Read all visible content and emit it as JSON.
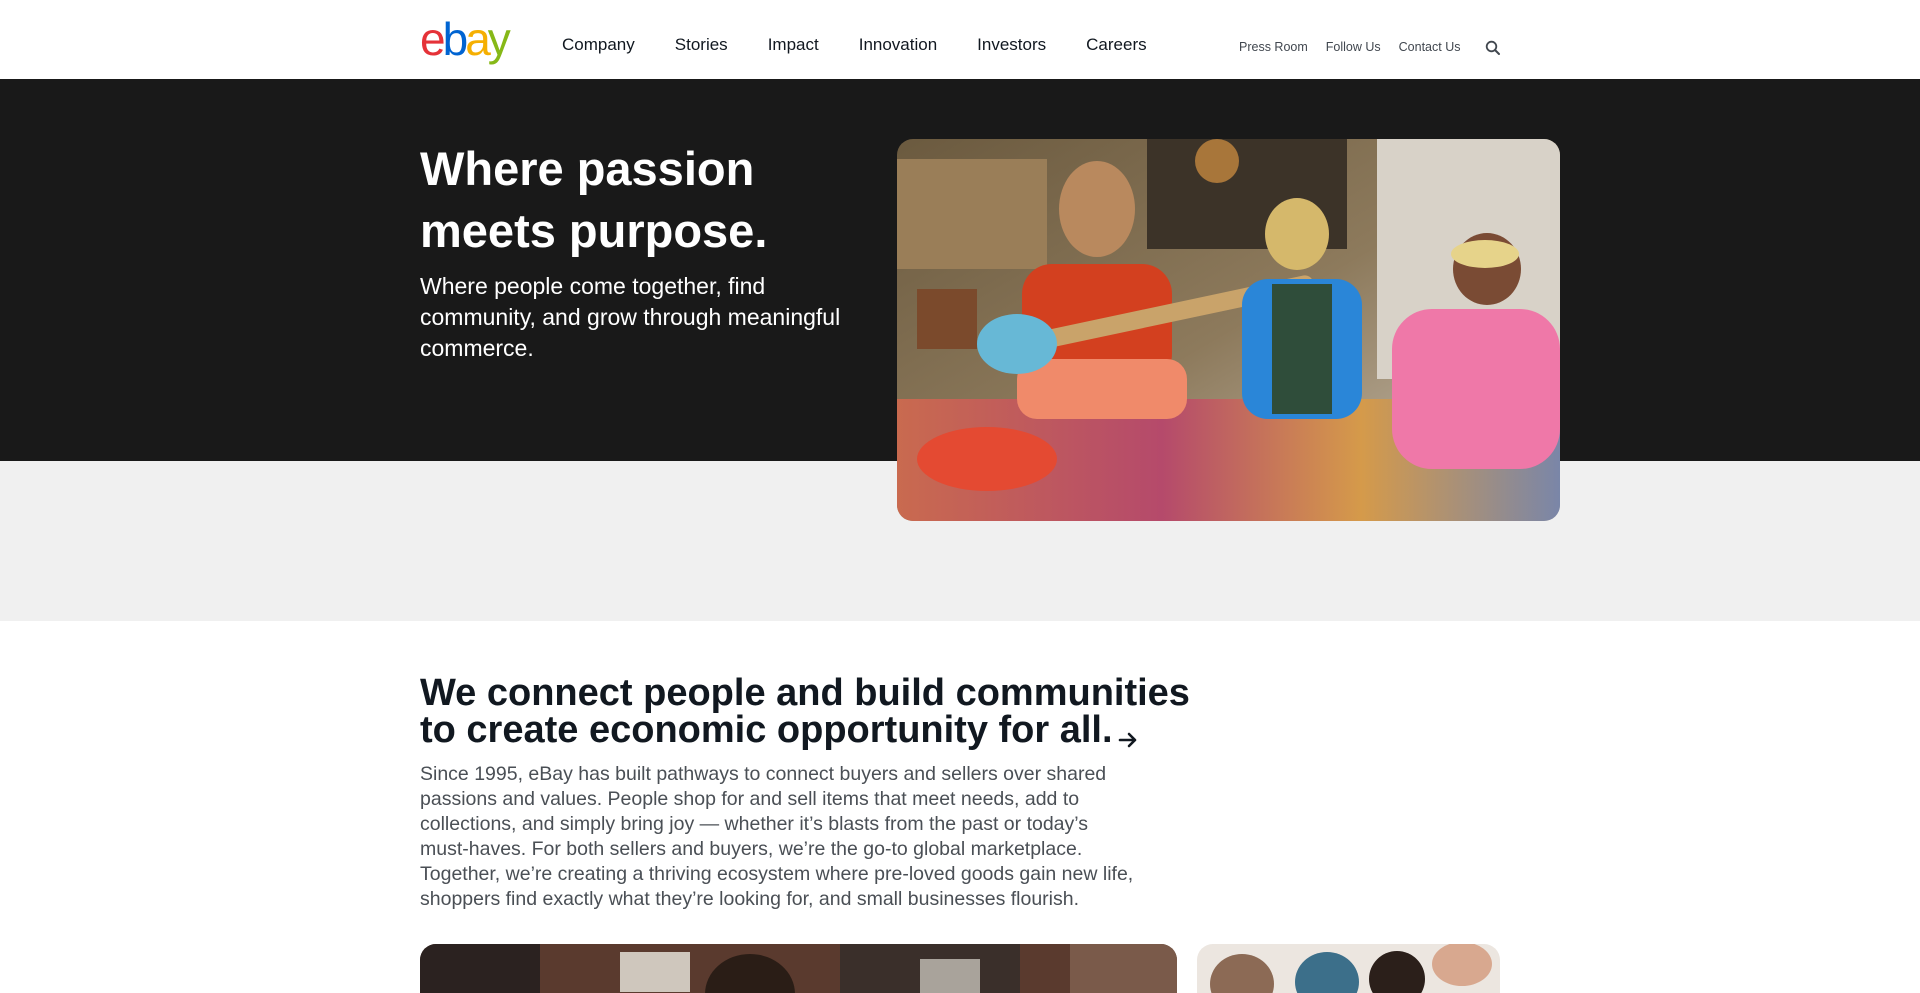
{
  "brand": {
    "logo_letters": [
      "e",
      "b",
      "a",
      "y"
    ],
    "colors": {
      "e": "#e53238",
      "b": "#0064d2",
      "a": "#f5af02",
      "y": "#86b817"
    }
  },
  "nav": {
    "main": [
      "Company",
      "Stories",
      "Impact",
      "Innovation",
      "Investors",
      "Careers"
    ],
    "utility": [
      "Press Room",
      "Follow Us",
      "Contact Us"
    ],
    "search_icon": "search-icon"
  },
  "hero": {
    "title": "Where passion meets purpose.",
    "subtitle": "Where people come together, find community, and grow through meaningful commerce.",
    "background": "#191919"
  },
  "mission": {
    "title": "We connect people and build communities to create economic opportunity for all.",
    "arrow_icon": "arrow-right-icon",
    "body": "Since 1995, eBay has built pathways to connect buyers and sellers over shared passions and values. People shop for and sell items that meet needs, add to collections, and simply bring joy — whether it’s blasts from the past or today’s must-haves. For both sellers and buyers, we’re the go-to global marketplace. Together, we’re creating a thriving ecosystem where pre-loved goods gain new life, shoppers find exactly what they’re looking for, and small businesses flourish."
  }
}
